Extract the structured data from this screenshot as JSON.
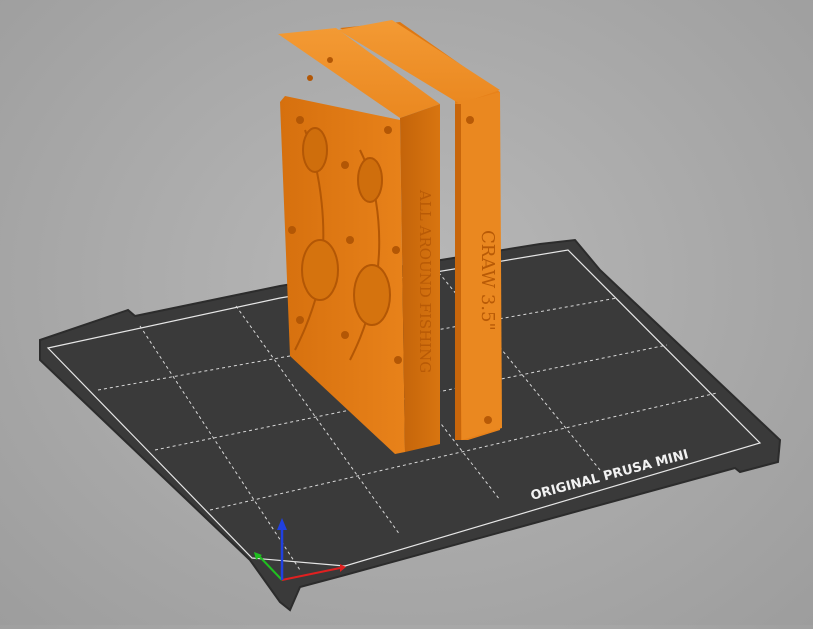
{
  "viewport": {
    "printer_bed": {
      "label": "ORIGINAL PRUSA MINI",
      "surface_color": "#3a3a3a",
      "grid_color": "#d8d8d8"
    },
    "model": {
      "color": "#e07a12",
      "left_part_text": "ALL AROUND FISHING",
      "right_part_text": "CRAW 3.5\""
    },
    "axes": {
      "x_color": "#e02020",
      "y_color": "#20c020",
      "z_color": "#2040e0"
    }
  }
}
